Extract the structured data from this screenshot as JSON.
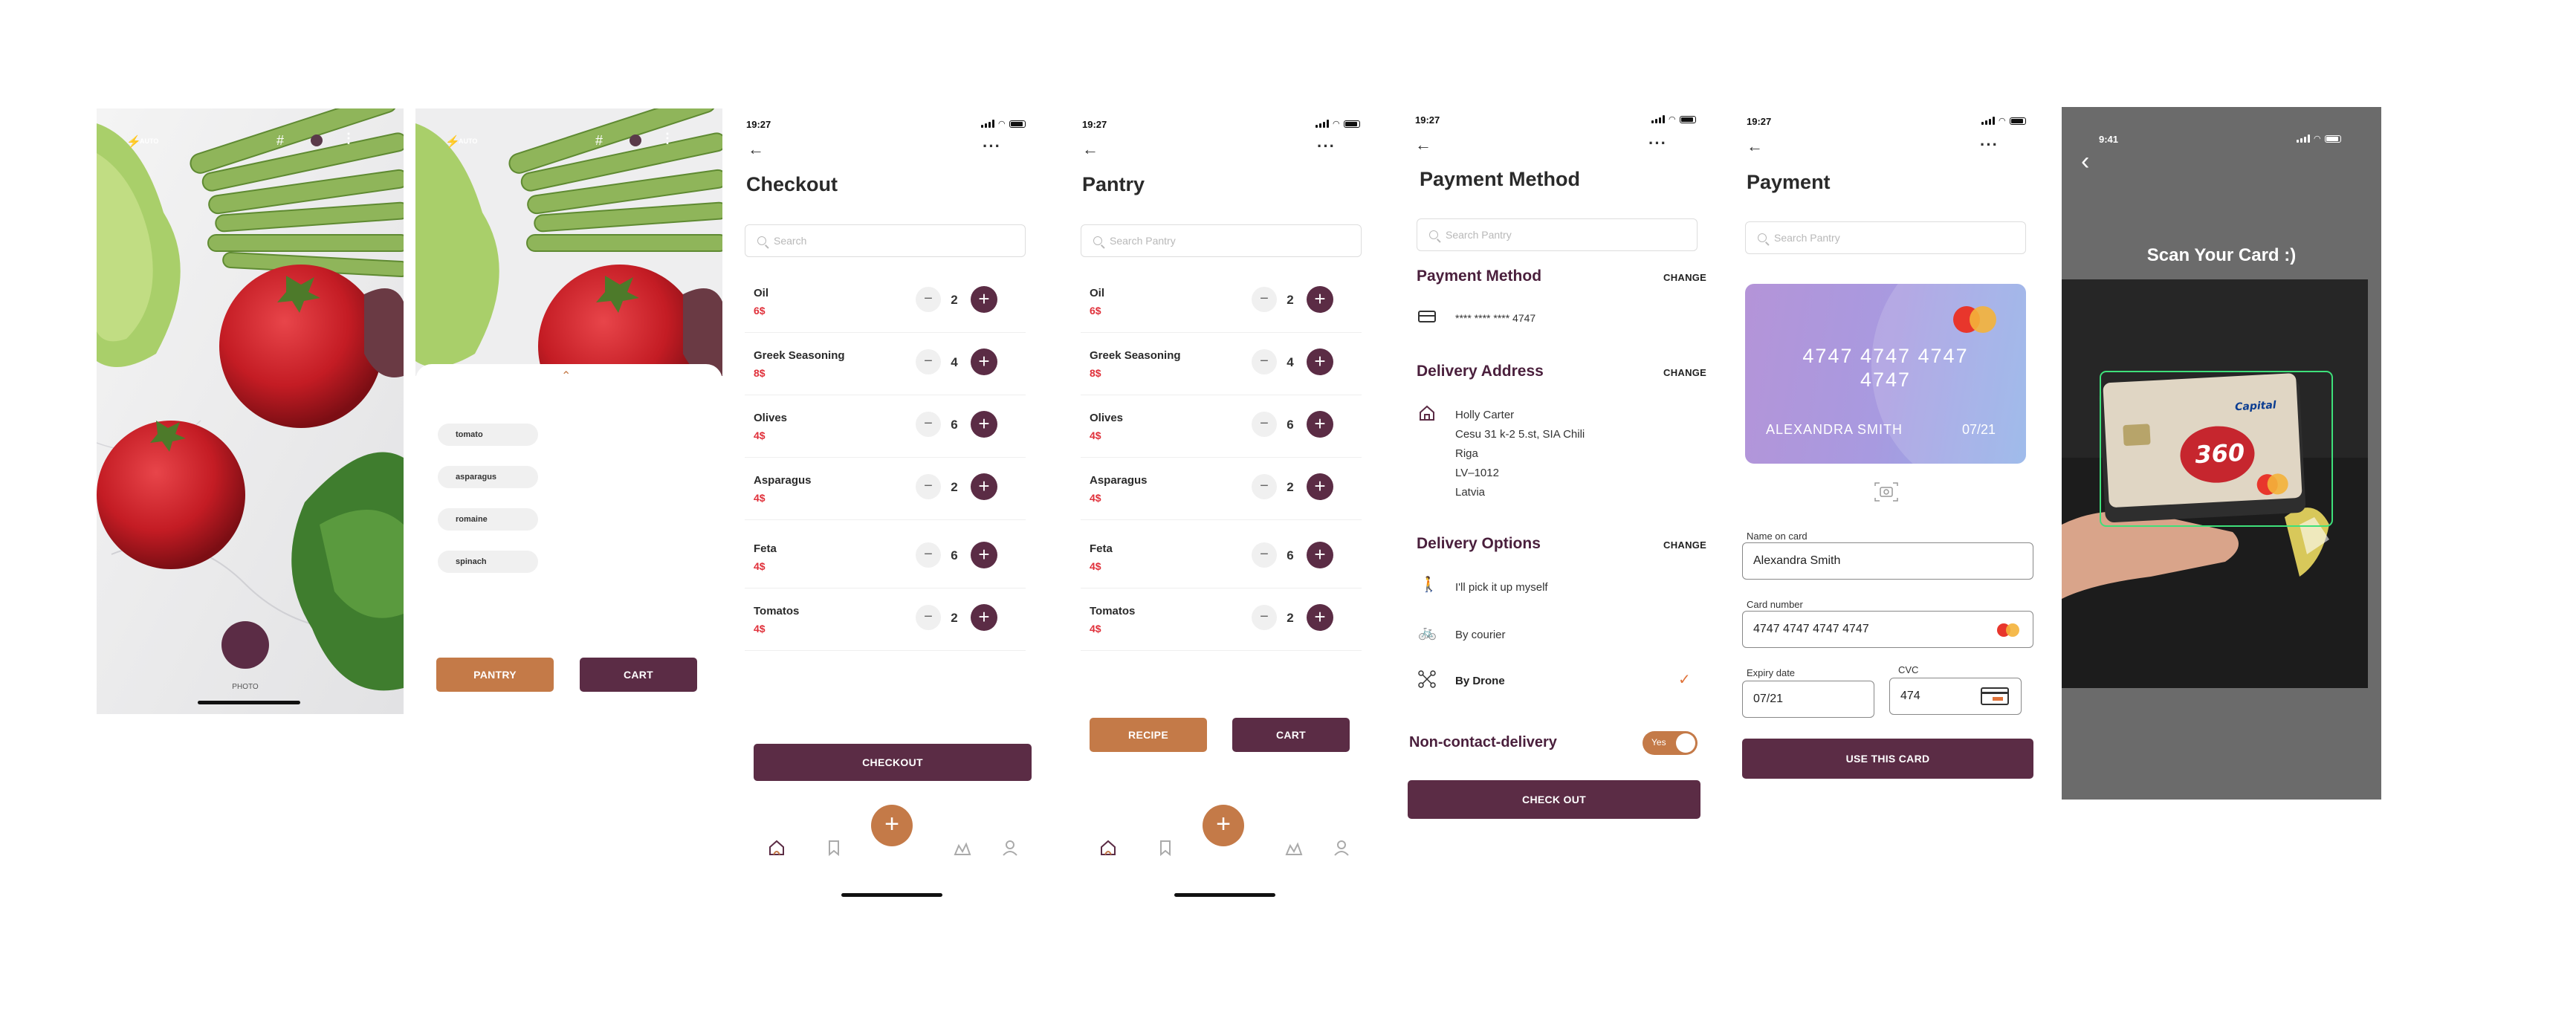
{
  "camera": {
    "flash_label": "AUTO",
    "photo_label": "PHOTO"
  },
  "suggestions": {
    "tags": [
      "tomato",
      "asparagus",
      "romaine",
      "spinach"
    ],
    "pantry_label": "PANTRY",
    "cart_label": "CART"
  },
  "checkout": {
    "time": "19:27",
    "title": "Checkout",
    "search_placeholder": "Search",
    "items": [
      {
        "name": "Oil",
        "price": "6$",
        "qty": "2"
      },
      {
        "name": "Greek Seasoning",
        "price": "8$",
        "qty": "4"
      },
      {
        "name": "Olives",
        "price": "4$",
        "qty": "6"
      },
      {
        "name": "Asparagus",
        "price": "4$",
        "qty": "2"
      },
      {
        "name": "Feta",
        "price": "4$",
        "qty": "6"
      },
      {
        "name": "Tomatos",
        "price": "4$",
        "qty": "2"
      }
    ],
    "checkout_label": "CHECKOUT",
    "fab_label": "+"
  },
  "pantry": {
    "time": "19:27",
    "title": "Pantry",
    "search_placeholder": "Search Pantry",
    "items": [
      {
        "name": "Oil",
        "price": "6$",
        "qty": "2"
      },
      {
        "name": "Greek Seasoning",
        "price": "8$",
        "qty": "4"
      },
      {
        "name": "Olives",
        "price": "4$",
        "qty": "6"
      },
      {
        "name": "Asparagus",
        "price": "4$",
        "qty": "2"
      },
      {
        "name": "Feta",
        "price": "4$",
        "qty": "6"
      },
      {
        "name": "Tomatos",
        "price": "4$",
        "qty": "2"
      }
    ],
    "recipe_label": "RECIPE",
    "cart_label": "CART",
    "fab_label": "+"
  },
  "payment_method": {
    "time": "19:27",
    "title": "Payment Method",
    "search_placeholder": "Search Pantry",
    "payment_section": "Payment Method",
    "card_masked": "**** **** **** 4747",
    "change_label": "CHANGE",
    "delivery_section": "Delivery Address",
    "address_lines": [
      "Holly Carter",
      "Cesu 31 k-2 5.st, SIA Chili",
      "Riga",
      "LV–1012",
      "Latvia"
    ],
    "options_section": "Delivery Options",
    "options": [
      "I'll pick it up myself",
      "By courier",
      "By Drone"
    ],
    "selected_option": "By Drone",
    "non_contact_label": "Non-contact-delivery",
    "toggle_label": "Yes",
    "checkout_label": "CHECK OUT"
  },
  "payment": {
    "time": "19:27",
    "title": "Payment",
    "search_placeholder": "Search Pantry",
    "card_number_display": [
      "4747  4747  4747",
      "4747"
    ],
    "card_holder": "ALEXANDRA SMITH",
    "card_expiry": "07/21",
    "name_label": "Name on card",
    "name_value": "Alexandra Smith",
    "number_label": "Card number",
    "number_value": "4747  4747  4747  4747",
    "expiry_label": "Expiry date",
    "expiry_value": "07/21",
    "cvc_label": "CVC",
    "cvc_value": "474",
    "use_card_label": "USE THIS CARD"
  },
  "scan": {
    "time": "9:41",
    "title": "Scan Your Card :)"
  },
  "colors": {
    "plum": "#5b2c45",
    "copper": "#c47a48",
    "price_red": "#e0303a"
  }
}
